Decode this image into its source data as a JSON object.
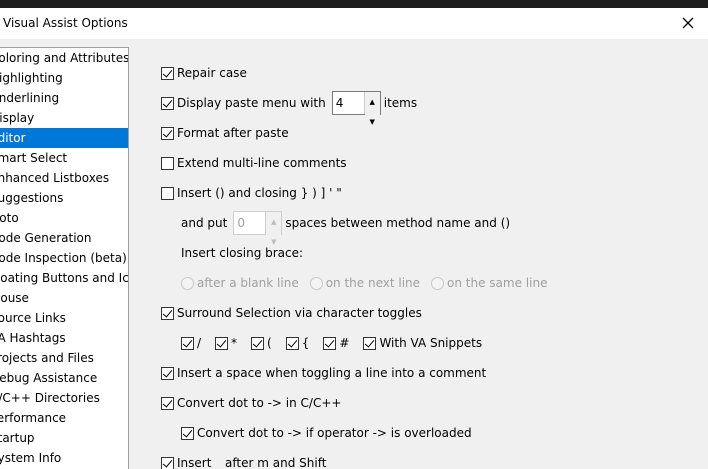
{
  "window": {
    "title": "Visual Assist Options"
  },
  "sidebar": {
    "items": [
      {
        "label": "Coloring and Attributes",
        "selected": false
      },
      {
        "label": "Highlighting",
        "selected": false
      },
      {
        "label": "Underlining",
        "selected": false
      },
      {
        "label": "Display",
        "selected": false
      },
      {
        "label": "Editor",
        "selected": true
      },
      {
        "label": "Smart Select",
        "selected": false
      },
      {
        "label": "Enhanced Listboxes",
        "selected": false
      },
      {
        "label": "Suggestions",
        "selected": false
      },
      {
        "label": "Goto",
        "selected": false
      },
      {
        "label": "Code Generation",
        "selected": false
      },
      {
        "label": "Code Inspection (beta)",
        "selected": false
      },
      {
        "label": "Floating Buttons and Icons",
        "selected": false
      },
      {
        "label": "Mouse",
        "selected": false
      },
      {
        "label": "Source Links",
        "selected": false
      },
      {
        "label": "VA Hashtags",
        "selected": false
      },
      {
        "label": "Projects and Files",
        "selected": false
      },
      {
        "label": "Debug Assistance",
        "selected": false
      },
      {
        "label": "C/C++ Directories",
        "selected": false
      },
      {
        "label": "Performance",
        "selected": false
      },
      {
        "label": "Startup",
        "selected": false
      },
      {
        "label": "System Info",
        "selected": false
      }
    ]
  },
  "editor": {
    "repair_case": {
      "label": "Repair case",
      "checked": true
    },
    "paste_menu": {
      "label_before": "Display paste menu with",
      "value": "4",
      "label_after": "items",
      "checked": true
    },
    "format_after_paste": {
      "label": "Format after paste",
      "checked": true
    },
    "extend_comments": {
      "label": "Extend multi-line comments",
      "checked": false
    },
    "insert_closing": {
      "label": "Insert () and closing } ) ] ' \"",
      "checked": false
    },
    "and_put": {
      "label_before": "and put",
      "value": "0",
      "label_after": "spaces between method name and ()"
    },
    "closing_brace": {
      "label": "Insert closing brace:"
    },
    "brace_options": [
      {
        "label": "after a blank line"
      },
      {
        "label": "on the next line"
      },
      {
        "label": "on the same line"
      }
    ],
    "surround": {
      "label": "Surround Selection via character toggles",
      "checked": true
    },
    "toggles": [
      {
        "label": "/",
        "checked": true
      },
      {
        "label": "*",
        "checked": true
      },
      {
        "label": "(",
        "checked": true
      },
      {
        "label": "{",
        "checked": true
      },
      {
        "label": "#",
        "checked": true
      },
      {
        "label": "With VA Snippets",
        "checked": true
      }
    ],
    "insert_space": {
      "label": "Insert a space when toggling a line into a comment",
      "checked": true
    },
    "convert_dot": {
      "label": "Convert dot to -> in C/C++",
      "checked": true
    },
    "convert_dot_overloaded": {
      "label": "Convert dot to -> if operator -> is overloaded",
      "checked": true
    },
    "insert_after_m": {
      "label": "Insert _ after m and Shift",
      "checked": true
    }
  }
}
